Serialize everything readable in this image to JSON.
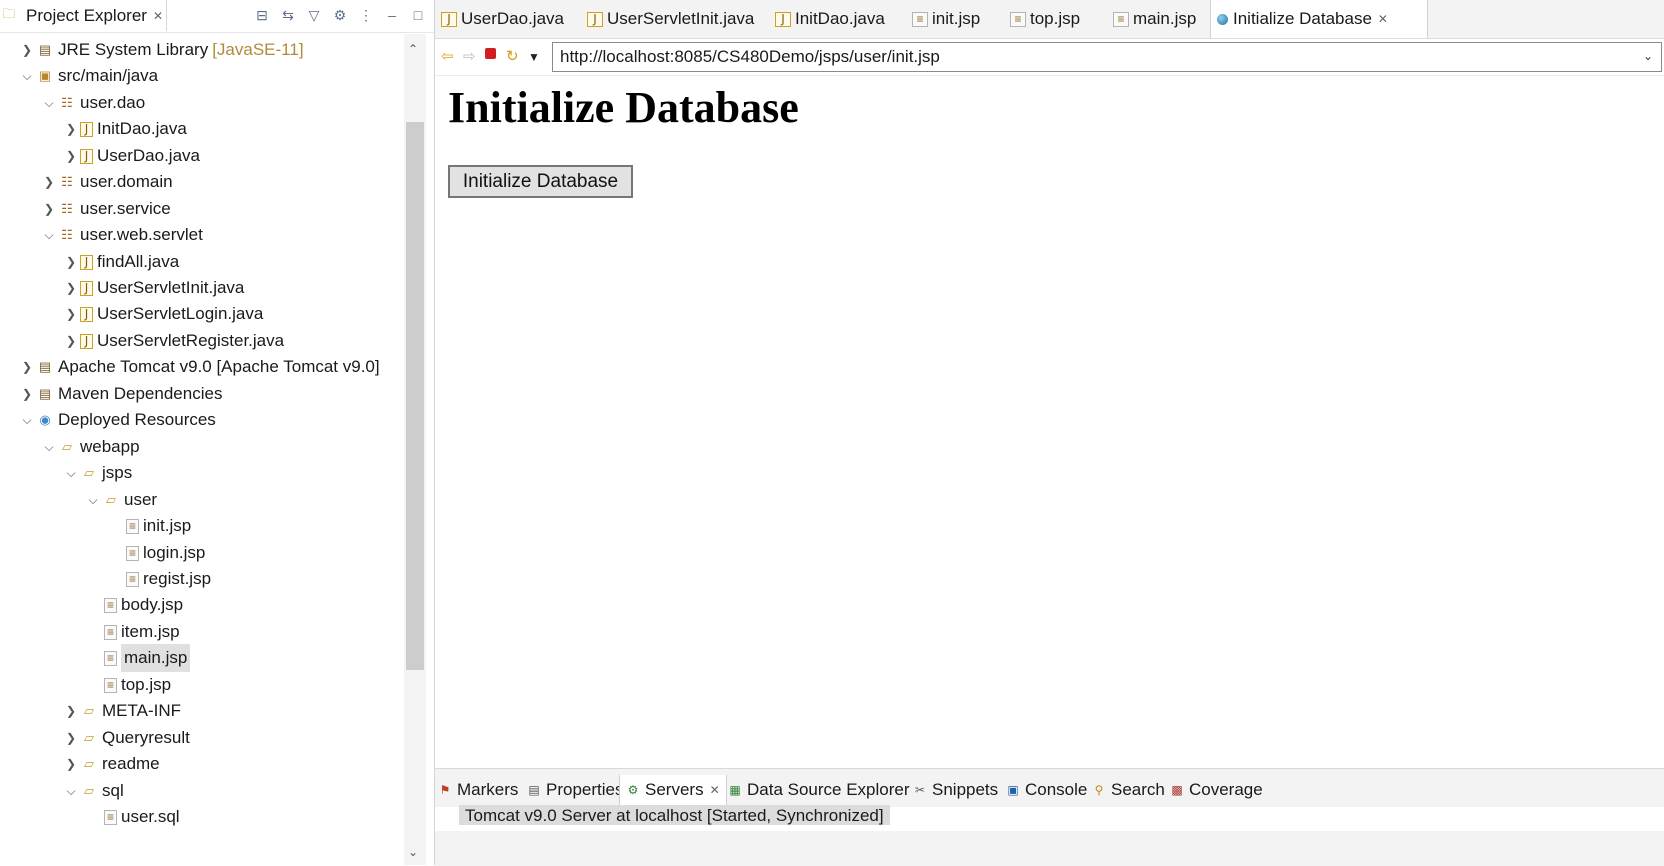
{
  "explorer": {
    "title": "Project Explorer",
    "tree": [
      {
        "label": "JRE System Library",
        "decoration": "[JavaSE-11]",
        "icon": "library-icon",
        "expanded": false
      },
      {
        "label": "src/main/java",
        "icon": "source-folder-icon",
        "expanded": true
      },
      {
        "label": "user.dao",
        "icon": "package-icon",
        "expanded": true
      },
      {
        "label": "InitDao.java",
        "icon": "java-file-icon",
        "expanded": false
      },
      {
        "label": "UserDao.java",
        "icon": "java-file-icon",
        "expanded": false
      },
      {
        "label": "user.domain",
        "icon": "package-icon",
        "expanded": false
      },
      {
        "label": "user.service",
        "icon": "package-icon",
        "expanded": false
      },
      {
        "label": "user.web.servlet",
        "icon": "package-icon",
        "expanded": true
      },
      {
        "label": "findAll.java",
        "icon": "java-file-icon",
        "expanded": false
      },
      {
        "label": "UserServletInit.java",
        "icon": "java-file-icon",
        "expanded": false
      },
      {
        "label": "UserServletLogin.java",
        "icon": "java-file-icon",
        "expanded": false
      },
      {
        "label": "UserServletRegister.java",
        "icon": "java-file-icon",
        "expanded": false
      },
      {
        "label": "Apache Tomcat v9.0 [Apache Tomcat v9.0]",
        "icon": "library-icon",
        "expanded": false
      },
      {
        "label": "Maven Dependencies",
        "icon": "library-icon",
        "expanded": false
      },
      {
        "label": "Deployed Resources",
        "icon": "deployed-resources-icon",
        "expanded": true
      },
      {
        "label": "webapp",
        "icon": "folder-icon",
        "expanded": true
      },
      {
        "label": "jsps",
        "icon": "folder-icon",
        "expanded": true
      },
      {
        "label": "user",
        "icon": "folder-icon",
        "expanded": true
      },
      {
        "label": "init.jsp",
        "icon": "jsp-file-icon"
      },
      {
        "label": "login.jsp",
        "icon": "jsp-file-icon"
      },
      {
        "label": "regist.jsp",
        "icon": "jsp-file-icon"
      },
      {
        "label": "body.jsp",
        "icon": "jsp-file-icon"
      },
      {
        "label": "item.jsp",
        "icon": "jsp-file-icon"
      },
      {
        "label": "main.jsp",
        "icon": "jsp-file-icon",
        "selected": true
      },
      {
        "label": "top.jsp",
        "icon": "jsp-file-icon"
      },
      {
        "label": "META-INF",
        "icon": "folder-icon",
        "expanded": false
      },
      {
        "label": "Queryresult",
        "icon": "folder-icon",
        "expanded": false
      },
      {
        "label": "readme",
        "icon": "folder-icon",
        "expanded": false
      },
      {
        "label": "sql",
        "icon": "folder-icon",
        "expanded": true
      },
      {
        "label": "user.sql",
        "icon": "sql-file-icon"
      }
    ]
  },
  "editor": {
    "tabs": [
      {
        "label": "UserDao.java",
        "icon": "java-file-icon"
      },
      {
        "label": "UserServletInit.java",
        "icon": "java-file-icon"
      },
      {
        "label": "InitDao.java",
        "icon": "java-file-icon"
      },
      {
        "label": "init.jsp",
        "icon": "jsp-file-icon"
      },
      {
        "label": "top.jsp",
        "icon": "jsp-file-icon"
      },
      {
        "label": "main.jsp",
        "icon": "jsp-file-icon"
      },
      {
        "label": "Initialize Database",
        "icon": "globe-icon",
        "active": true
      }
    ],
    "url": "http://localhost:8085/CS480Demo/jsps/user/init.jsp"
  },
  "page": {
    "heading": "Initialize Database",
    "button_label": "Initialize Database"
  },
  "bottom_panel": {
    "tabs": [
      {
        "label": "Markers",
        "icon": "markers-icon"
      },
      {
        "label": "Properties",
        "icon": "properties-icon"
      },
      {
        "label": "Servers",
        "icon": "servers-icon",
        "active": true
      },
      {
        "label": "Data Source Explorer",
        "icon": "data-source-icon"
      },
      {
        "label": "Snippets",
        "icon": "snippets-icon"
      },
      {
        "label": "Console",
        "icon": "console-icon"
      },
      {
        "label": "Search",
        "icon": "search-icon"
      },
      {
        "label": "Coverage",
        "icon": "coverage-icon"
      }
    ],
    "server_entry": "Tomcat v9.0 Server at localhost  [Started, Synchronized]"
  }
}
